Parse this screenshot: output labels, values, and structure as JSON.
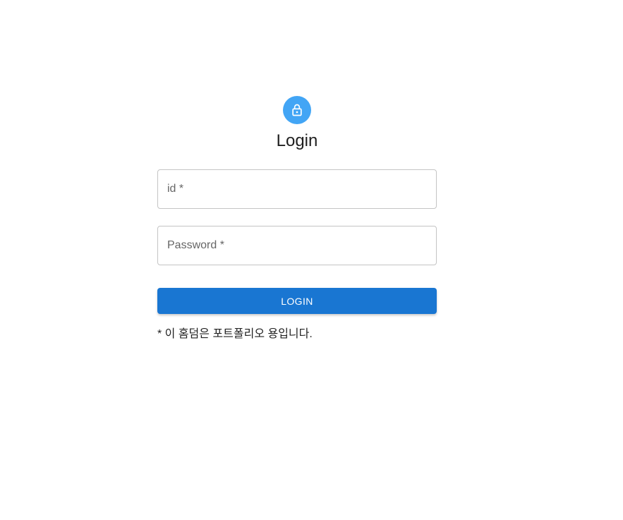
{
  "colors": {
    "avatar_bg": "#42a5f5",
    "button_bg": "#1976d2",
    "field_border": "#c4c4c4",
    "label": "#666666"
  },
  "header": {
    "icon": "lock-icon",
    "title": "Login"
  },
  "form": {
    "id_field": {
      "label": "id *",
      "value": ""
    },
    "password_field": {
      "label": "Password *",
      "value": ""
    },
    "submit_label": "LOGIN"
  },
  "footer": {
    "note": "* 이 홈덤은 포트폴리오 용입니다."
  }
}
